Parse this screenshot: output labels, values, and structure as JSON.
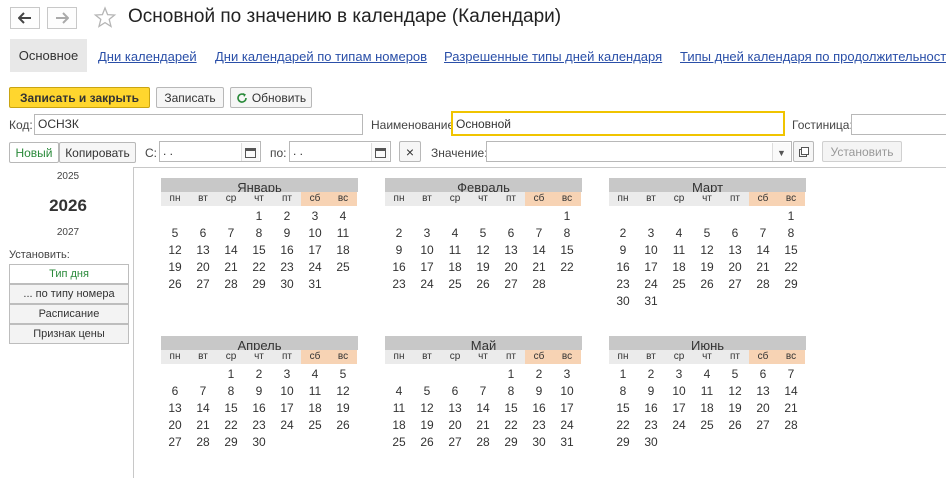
{
  "header": {
    "title": "Основной по значению в календаре (Календари)"
  },
  "tabs": [
    {
      "label": "Основное"
    },
    {
      "label": "Дни календарей"
    },
    {
      "label": "Дни календарей по типам номеров"
    },
    {
      "label": "Разрешенные типы дней календаря"
    },
    {
      "label": "Типы дней календаря по продолжительност"
    }
  ],
  "toolbar": {
    "save_close_label": "Записать и закрыть",
    "save_label": "Записать",
    "refresh_label": "Обновить"
  },
  "form": {
    "code_label": "Код:",
    "code_value": "ОСНЗК",
    "name_label": "Наименование:",
    "name_value": "Основной",
    "hotel_label": "Гостиница:",
    "hotel_value": ""
  },
  "filter": {
    "new_label": "Новый",
    "copy_label": "Копировать",
    "from_label": "С:",
    "from_value": " .  .",
    "to_label": "по:",
    "to_value": " .  .",
    "clear_label": "×",
    "value_label": "Значение:",
    "value_value": "",
    "set_label": "Установить"
  },
  "years": {
    "prev": "2025",
    "current": "2026",
    "next": "2027"
  },
  "set_panel": {
    "label": "Установить:",
    "buttons": [
      "Тип дня",
      "... по типу номера",
      "Расписание",
      "Признак цены"
    ]
  },
  "colors": {
    "accent": "#ffd62e",
    "link": "#2a4fa8",
    "weekend": "#f7d3b4",
    "month_header": "#c8c8c8"
  },
  "weekdays": [
    "пн",
    "вт",
    "ср",
    "чт",
    "пт",
    "сб",
    "вс"
  ],
  "months": [
    {
      "name": "Январь",
      "start": 3,
      "days": 31
    },
    {
      "name": "Февраль",
      "start": 6,
      "days": 28
    },
    {
      "name": "Март",
      "start": 6,
      "days": 31
    },
    {
      "name": "Апрель",
      "start": 2,
      "days": 30
    },
    {
      "name": "Май",
      "start": 4,
      "days": 31
    },
    {
      "name": "Июнь",
      "start": 0,
      "days": 30
    }
  ]
}
